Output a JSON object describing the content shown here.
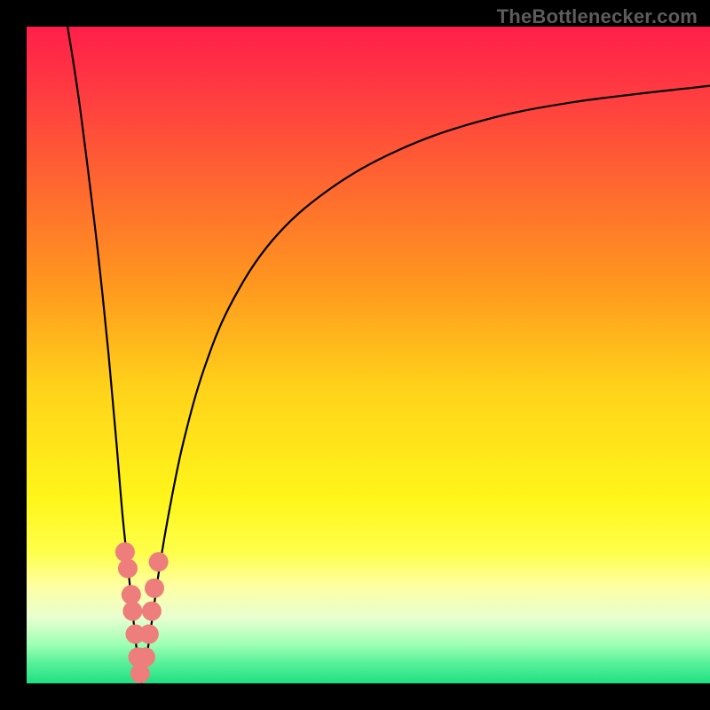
{
  "watermark": "TheBottlenecker.com",
  "chart_data": {
    "type": "line",
    "title": "",
    "xlabel": "",
    "ylabel": "",
    "xlim": [
      0,
      100
    ],
    "ylim": [
      0,
      100
    ],
    "grid": false,
    "gradient_stops": [
      {
        "offset": 0.0,
        "color": "#ff1f4a"
      },
      {
        "offset": 0.1,
        "color": "#ff3b41"
      },
      {
        "offset": 0.25,
        "color": "#ff6a2f"
      },
      {
        "offset": 0.4,
        "color": "#ff9a1e"
      },
      {
        "offset": 0.55,
        "color": "#ffd21a"
      },
      {
        "offset": 0.72,
        "color": "#fff61a"
      },
      {
        "offset": 0.8,
        "color": "#ffff4a"
      },
      {
        "offset": 0.85,
        "color": "#ffffa0"
      },
      {
        "offset": 0.9,
        "color": "#e8ffd0"
      },
      {
        "offset": 0.94,
        "color": "#a0ffb4"
      },
      {
        "offset": 0.97,
        "color": "#56f09a"
      },
      {
        "offset": 1.0,
        "color": "#1fe080"
      }
    ],
    "series": [
      {
        "name": "curve-left",
        "points": [
          {
            "x": 6.0,
            "y": 100.0
          },
          {
            "x": 7.5,
            "y": 90.0
          },
          {
            "x": 9.0,
            "y": 78.0
          },
          {
            "x": 10.5,
            "y": 65.0
          },
          {
            "x": 12.0,
            "y": 50.0
          },
          {
            "x": 13.2,
            "y": 36.0
          },
          {
            "x": 14.0,
            "y": 26.0
          },
          {
            "x": 14.8,
            "y": 18.0
          },
          {
            "x": 15.4,
            "y": 12.0
          },
          {
            "x": 15.9,
            "y": 7.0
          },
          {
            "x": 16.3,
            "y": 3.5
          },
          {
            "x": 16.6,
            "y": 1.5
          },
          {
            "x": 16.8,
            "y": 0.0
          }
        ]
      },
      {
        "name": "curve-right",
        "points": [
          {
            "x": 16.8,
            "y": 0.0
          },
          {
            "x": 17.2,
            "y": 2.0
          },
          {
            "x": 17.7,
            "y": 5.0
          },
          {
            "x": 18.4,
            "y": 10.0
          },
          {
            "x": 19.5,
            "y": 18.0
          },
          {
            "x": 21.0,
            "y": 27.0
          },
          {
            "x": 23.0,
            "y": 37.0
          },
          {
            "x": 26.0,
            "y": 48.0
          },
          {
            "x": 30.0,
            "y": 58.0
          },
          {
            "x": 36.0,
            "y": 67.5
          },
          {
            "x": 44.0,
            "y": 75.0
          },
          {
            "x": 54.0,
            "y": 81.0
          },
          {
            "x": 66.0,
            "y": 85.5
          },
          {
            "x": 80.0,
            "y": 88.5
          },
          {
            "x": 100.0,
            "y": 91.0
          }
        ]
      }
    ],
    "markers": [
      {
        "x": 14.4,
        "y": 20.0
      },
      {
        "x": 14.8,
        "y": 17.5
      },
      {
        "x": 15.3,
        "y": 13.5
      },
      {
        "x": 15.5,
        "y": 11.0
      },
      {
        "x": 15.9,
        "y": 7.5
      },
      {
        "x": 16.3,
        "y": 4.0
      },
      {
        "x": 16.6,
        "y": 1.5
      },
      {
        "x": 17.4,
        "y": 4.0
      },
      {
        "x": 17.9,
        "y": 7.5
      },
      {
        "x": 18.3,
        "y": 11.0
      },
      {
        "x": 18.7,
        "y": 14.5
      },
      {
        "x": 19.3,
        "y": 18.5
      }
    ],
    "marker_style": {
      "color": "#ee7e7b",
      "radius": 11
    }
  }
}
